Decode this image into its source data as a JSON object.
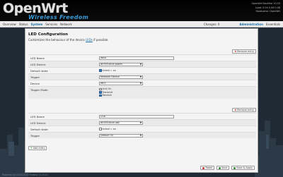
{
  "header": {
    "brand": "OpenWrt",
    "tagline": "Wireless Freedom",
    "sysinfo": [
      "OpenWrt Backfire 10.03",
      "Load: 0.04 0.06 0.06",
      "Hostname: OpenWrt"
    ]
  },
  "menu": {
    "items": [
      "Overview",
      "Status",
      "System",
      "Services",
      "Network"
    ],
    "active": "System",
    "changes": "Changes: 0",
    "right_items": [
      "Administration",
      "Essentials"
    ],
    "right_active": "Administration"
  },
  "page": {
    "title": "LED Configuration",
    "desc_pre": "Customizes the behaviour of the device ",
    "desc_link": "LEDs",
    "desc_post": " if possible."
  },
  "labels": {
    "remove": "Remove entry",
    "add": "Add entry",
    "name": "LED Name",
    "device": "LED Device",
    "default_state": "Default state",
    "ticked_on": "ticked = on",
    "trigger": "Trigger",
    "netdev": "Device",
    "trigger_mode": "Trigger Mode"
  },
  "led1": {
    "name": "WAN",
    "device": "dir505:blue:power",
    "default_checked": true,
    "trigger": "Network Device",
    "netdev": "eth1",
    "modes": [
      {
        "label": "Link On",
        "checked": false
      },
      {
        "label": "Transmit",
        "checked": true
      },
      {
        "label": "Receive",
        "checked": true
      }
    ]
  },
  "led2": {
    "name": "USB",
    "device": "dir505:blue:usb",
    "default_checked": false,
    "trigger": "Default On"
  },
  "actions": {
    "reset": "Reset",
    "save": "Save",
    "save_apply": "Save & Apply"
  },
  "footer": "Powered by LuCI 0.10.0 Release (0.10.0)",
  "colors": {
    "accent": "#1a6ea5",
    "tagline": "#3a9bd8",
    "background": "#1f2a35"
  }
}
